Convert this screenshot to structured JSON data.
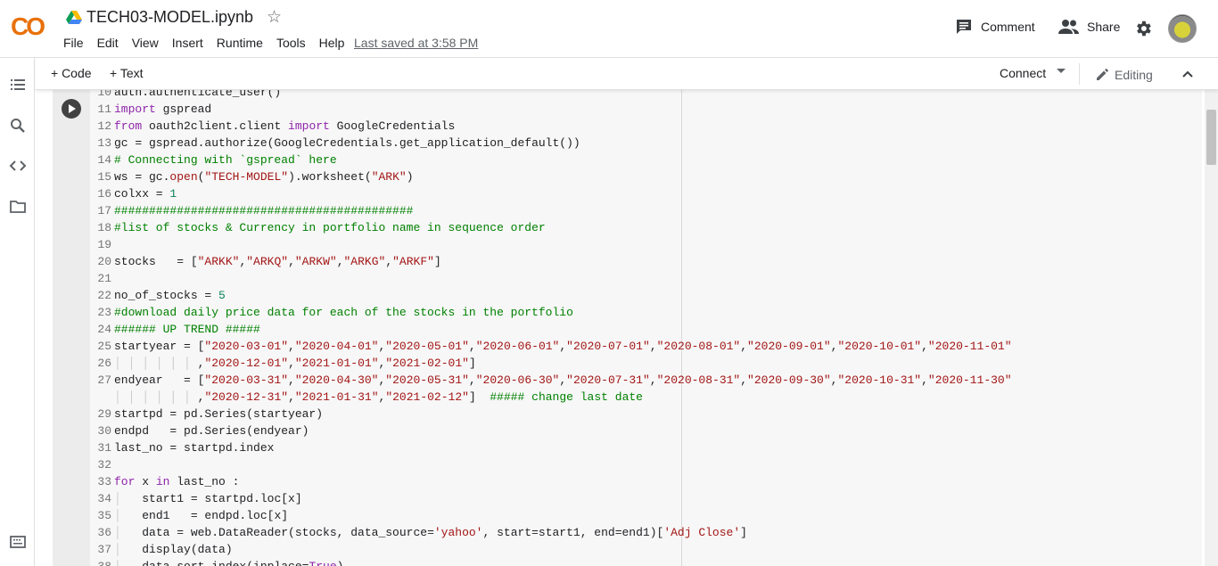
{
  "header": {
    "logo_text": "CO",
    "title": "TECH03-MODEL.ipynb",
    "menu": [
      "File",
      "Edit",
      "View",
      "Insert",
      "Runtime",
      "Tools",
      "Help"
    ],
    "last_saved": "Last saved at 3:58 PM",
    "comment_label": "Comment",
    "share_label": "Share"
  },
  "toolbar": {
    "add_code": "+ Code",
    "add_text": "+ Text",
    "connect": "Connect",
    "editing": "Editing"
  },
  "sidebar": {
    "icons": [
      "toc-icon",
      "search-icon",
      "code-snippets-icon",
      "folder-icon",
      "terminal-icon"
    ]
  },
  "code": {
    "lines": [
      {
        "n": "10",
        "html": "auth.authenticate_user()"
      },
      {
        "n": "11",
        "html": "<span class='kw'>import</span> gspread"
      },
      {
        "n": "12",
        "html": "<span class='kw'>from</span> oauth2client.client <span class='kw'>import</span> GoogleCredentials"
      },
      {
        "n": "13",
        "html": "gc = gspread.authorize(GoogleCredentials.get_application_default())"
      },
      {
        "n": "14",
        "html": "<span class='cm'># Connecting with `gspread` here</span>"
      },
      {
        "n": "15",
        "html": "ws = gc.<span class='st'>open</span>(<span class='st'>\"TECH-MODEL\"</span>).worksheet(<span class='st'>\"ARK\"</span>)"
      },
      {
        "n": "16",
        "html": "colxx = <span class='nm'>1</span>"
      },
      {
        "n": "17",
        "html": "<span class='cm'>###########################################</span>"
      },
      {
        "n": "18",
        "html": "<span class='cm'>#list of stocks &amp; Currency in portfolio name in sequence order</span>"
      },
      {
        "n": "19",
        "html": ""
      },
      {
        "n": "20",
        "html": "stocks   = [<span class='st'>\"ARKK\"</span>,<span class='st'>\"ARKQ\"</span>,<span class='st'>\"ARKW\"</span>,<span class='st'>\"ARKG\"</span>,<span class='st'>\"ARKF\"</span>]"
      },
      {
        "n": "21",
        "html": ""
      },
      {
        "n": "22",
        "html": "no_of_stocks = <span class='nm'>5</span>"
      },
      {
        "n": "23",
        "html": "<span class='cm'>#download daily price data for each of the stocks in the portfolio</span>"
      },
      {
        "n": "24",
        "html": "<span class='cm'>###### UP TREND #####</span>"
      },
      {
        "n": "25",
        "html": "startyear = [<span class='st'>\"2020-03-01\"</span>,<span class='st'>\"2020-04-01\"</span>,<span class='st'>\"2020-05-01\"</span>,<span class='st'>\"2020-06-01\"</span>,<span class='st'>\"2020-07-01\"</span>,<span class='st'>\"2020-08-01\"</span>,<span class='st'>\"2020-09-01\"</span>,<span class='st'>\"2020-10-01\"</span>,<span class='st'>\"2020-11-01\"</span>"
      },
      {
        "n": "26",
        "html": "<span class='gu'>│ │ │ │ │ │</span> ,<span class='st'>\"2020-12-01\"</span>,<span class='st'>\"2021-01-01\"</span>,<span class='st'>\"2021-02-01\"</span>]"
      },
      {
        "n": "27",
        "html": "endyear   = [<span class='st'>\"2020-03-31\"</span>,<span class='st'>\"2020-04-30\"</span>,<span class='st'>\"2020-05-31\"</span>,<span class='st'>\"2020-06-30\"</span>,<span class='st'>\"2020-07-31\"</span>,<span class='st'>\"2020-08-31\"</span>,<span class='st'>\"2020-09-30\"</span>,<span class='st'>\"2020-10-31\"</span>,<span class='st'>\"2020-11-30\"</span>"
      },
      {
        "n": "",
        "html": "<span class='gu'>│ │ │ │ │ │</span> ,<span class='st'>\"2020-12-31\"</span>,<span class='st'>\"2021-01-31\"</span>,<span class='st'>\"2021-02-12\"</span>]  <span class='cm'>##### change last date</span>"
      },
      {
        "n": "29",
        "html": "startpd = pd.Series(startyear)"
      },
      {
        "n": "30",
        "html": "endpd   = pd.Series(endyear)"
      },
      {
        "n": "31",
        "html": "last_no = startpd.index"
      },
      {
        "n": "32",
        "html": ""
      },
      {
        "n": "33",
        "html": "<span class='kw'>for</span> x <span class='kw'>in</span> last_no :"
      },
      {
        "n": "34",
        "html": "<span class='gu'>│</span>   start1 = startpd.loc[x]"
      },
      {
        "n": "35",
        "html": "<span class='gu'>│</span>   end1   = endpd.loc[x]"
      },
      {
        "n": "36",
        "html": "<span class='gu'>│</span>   data = web.DataReader(stocks, data_source=<span class='st'>'yahoo'</span>, start=start1, end=end1)[<span class='st'>'Adj Close'</span>]"
      },
      {
        "n": "37",
        "html": "<span class='gu'>│</span>   display(data)"
      },
      {
        "n": "38",
        "html": "<span class='gu'>│</span>   data.sort_index(inplace=<span class='kw'>True</span>)"
      }
    ]
  }
}
